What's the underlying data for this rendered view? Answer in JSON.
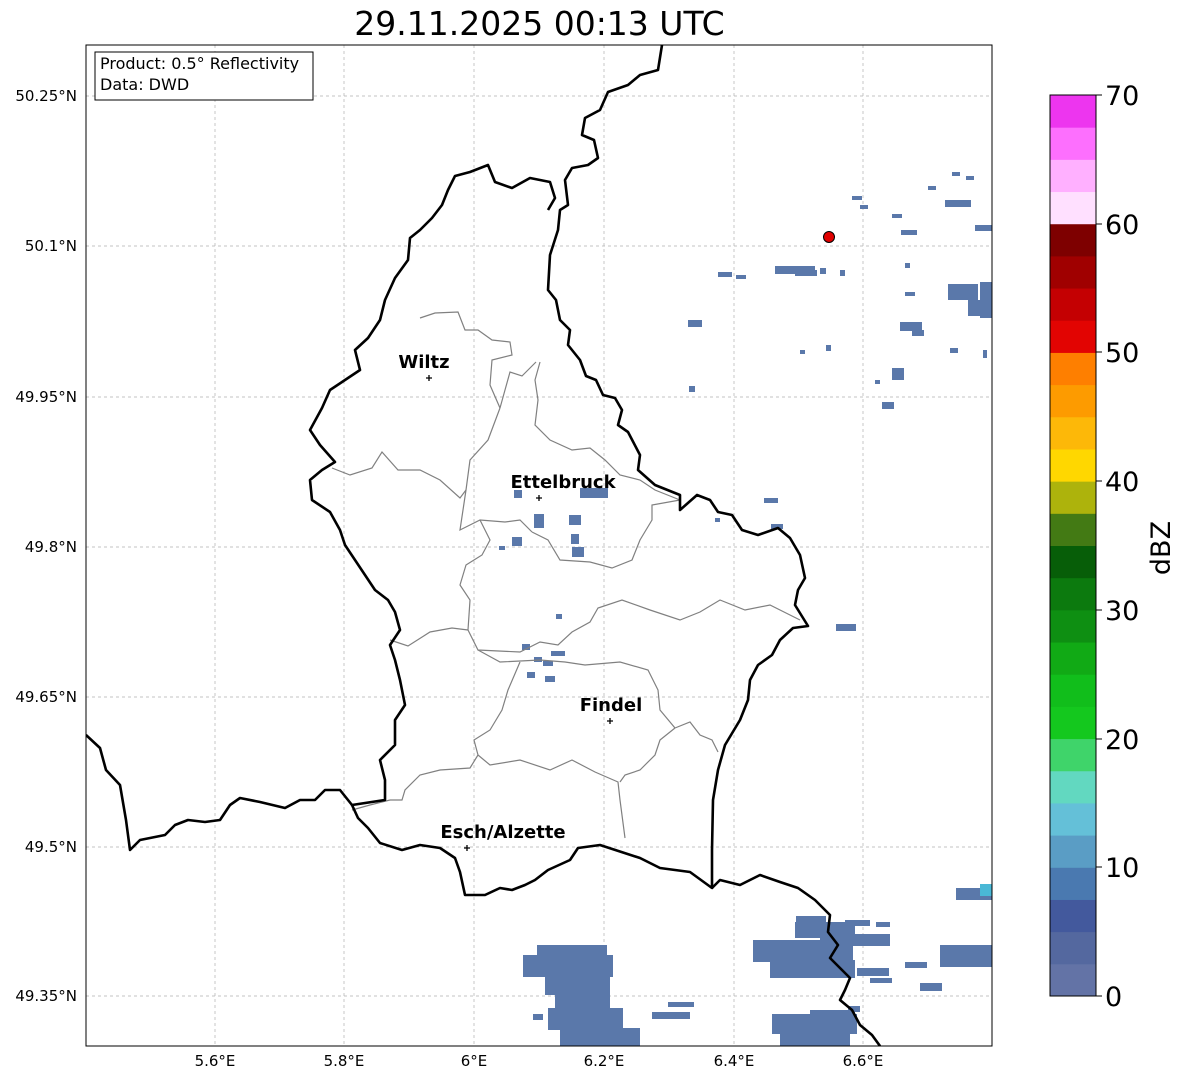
{
  "title": "29.11.2025 00:13 UTC",
  "info": {
    "product": "Product: 0.5° Reflectivity",
    "data_source": "Data: DWD"
  },
  "axes": {
    "lon_ticks": [
      "5.6°E",
      "5.8°E",
      "6°E",
      "6.2°E",
      "6.4°E",
      "6.6°E"
    ],
    "lat_ticks": [
      "50.25°N",
      "50.1°N",
      "49.95°N",
      "49.8°N",
      "49.65°N",
      "49.5°N",
      "49.35°N"
    ]
  },
  "cities": [
    {
      "name": "Wiltz"
    },
    {
      "name": "Ettelbruck"
    },
    {
      "name": "Findel"
    },
    {
      "name": "Esch/Alzette"
    }
  ],
  "colorbar": {
    "label": "dBZ",
    "ticks": [
      "70",
      "60",
      "50",
      "40",
      "30",
      "20",
      "10",
      "0"
    ],
    "colors": [
      "#6373a6",
      "#54689f",
      "#43599d",
      "#4a79b0",
      "#5a9dc5",
      "#64c0d8",
      "#62d8c0",
      "#3fd46a",
      "#14c81e",
      "#11be1b",
      "#11aa15",
      "#0e8f12",
      "#0c7a0e",
      "#075e08",
      "#437a14",
      "#adb30c",
      "#ffd700",
      "#fdb808",
      "#fd9b00",
      "#fe7f00",
      "#e20402",
      "#c40002",
      "#a00000",
      "#7e0000",
      "#ffe0ff",
      "#ffb0ff",
      "#fd6ffe",
      "#ed35ef"
    ]
  },
  "colors": {
    "echo": "#5a78aa",
    "border": "#000000",
    "canton": "#808080",
    "radar_marker": "#e00000"
  },
  "icons": {
    "city_marker": "plus-marker-icon",
    "radar_site": "red-dot-icon"
  }
}
